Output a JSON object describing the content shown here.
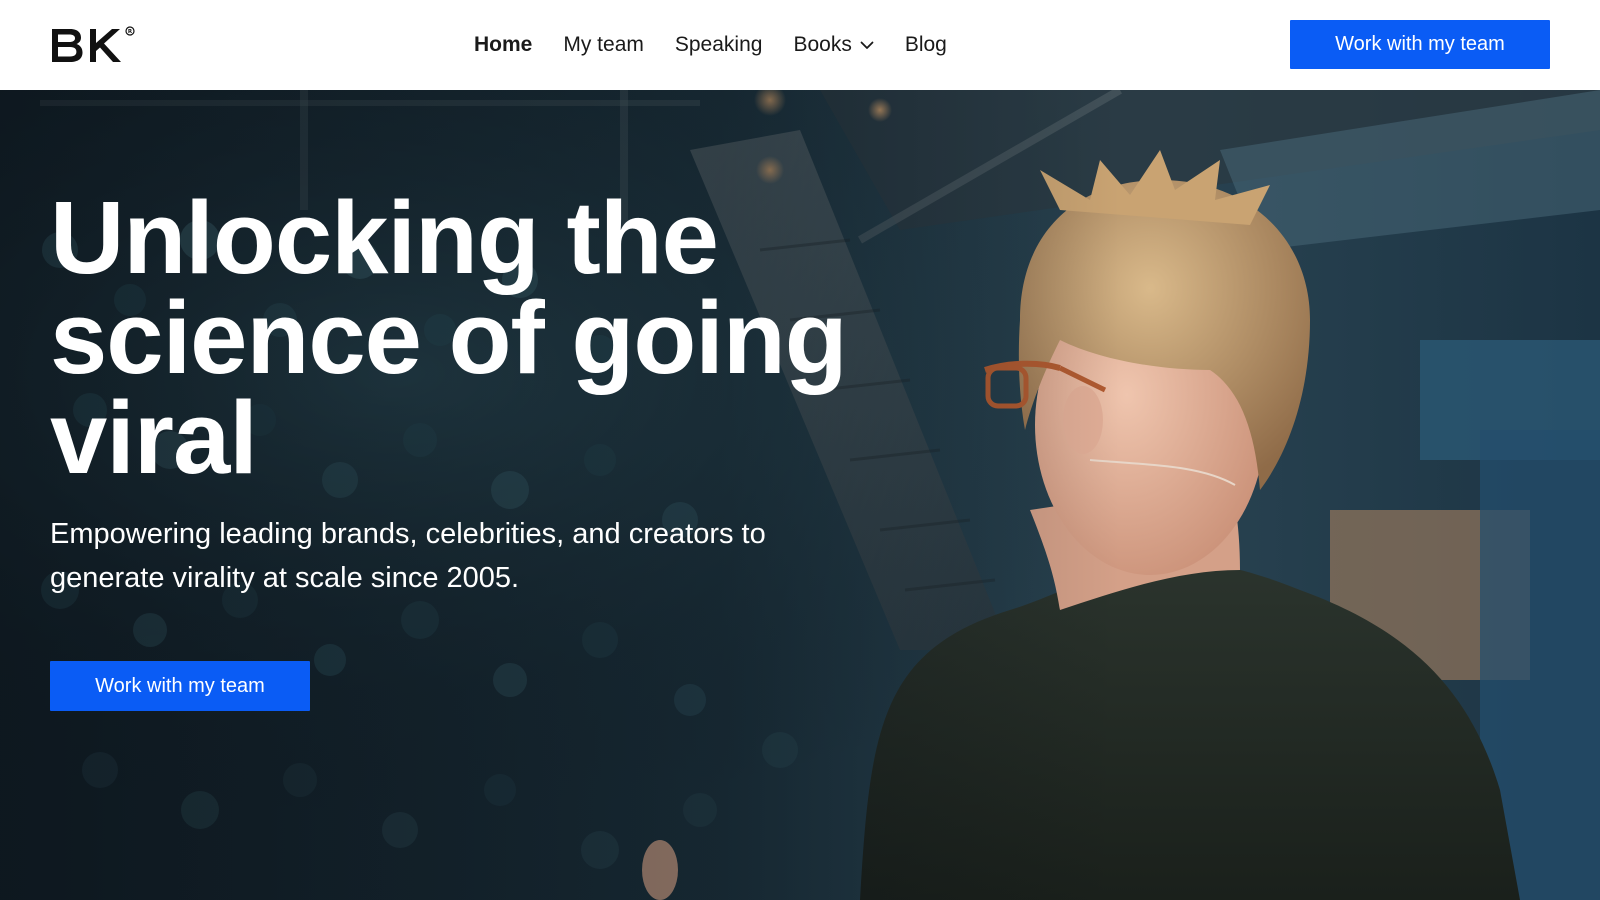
{
  "header": {
    "logo_text": "BK",
    "nav": [
      {
        "label": "Home",
        "active": true
      },
      {
        "label": "My team",
        "active": false
      },
      {
        "label": "Speaking",
        "active": false
      },
      {
        "label": "Books",
        "active": false,
        "has_dropdown": true
      },
      {
        "label": "Blog",
        "active": false
      }
    ],
    "cta_label": "Work with my team"
  },
  "hero": {
    "headline": "Unlocking the science of going viral",
    "subheadline": "Empowering leading brands, celebrities, and creators to generate virality at scale since 2005.",
    "cta_label": "Work with my team",
    "image_subject": "speaker-on-stage-facing-audience"
  },
  "icons": {
    "dropdown": "chevron-down-icon",
    "trademark": "registered-mark-icon"
  },
  "colors": {
    "accent": "#0a5cf5",
    "header_bg": "#ffffff",
    "hero_text": "#ffffff"
  }
}
